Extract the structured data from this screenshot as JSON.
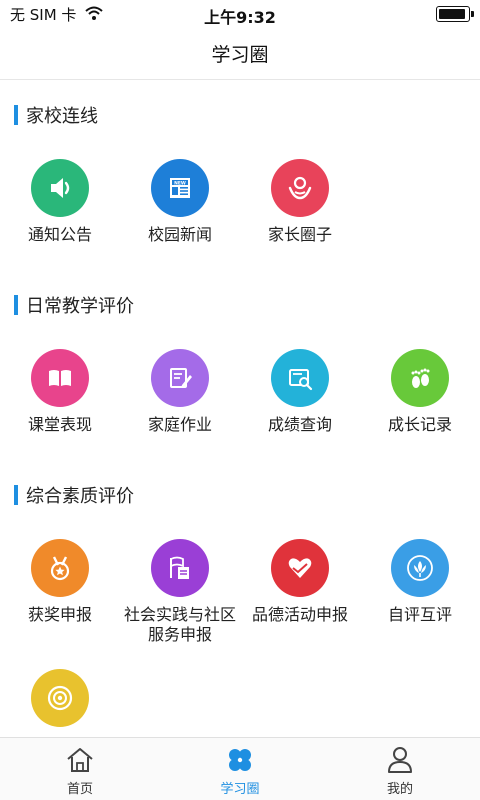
{
  "status_bar": {
    "carrier": "无 SIM 卡",
    "time": "上午9:32"
  },
  "header": {
    "title": "学习圈"
  },
  "sections": [
    {
      "title": "家校连线",
      "items": [
        {
          "label": "通知公告",
          "icon": "speaker-icon",
          "color": "#2ab77a"
        },
        {
          "label": "校园新闻",
          "icon": "newspaper-icon",
          "color": "#1e7fd8"
        },
        {
          "label": "家长圈子",
          "icon": "parent-child-icon",
          "color": "#e8435a"
        }
      ]
    },
    {
      "title": "日常教学评价",
      "items": [
        {
          "label": "课堂表现",
          "icon": "book-icon",
          "color": "#e8448c"
        },
        {
          "label": "家庭作业",
          "icon": "homework-pen-icon",
          "color": "#a46be8"
        },
        {
          "label": "成绩查询",
          "icon": "search-record-icon",
          "color": "#23b2d9"
        },
        {
          "label": "成长记录",
          "icon": "footprint-icon",
          "color": "#68c93a"
        }
      ]
    },
    {
      "title": "综合素质评价",
      "items": [
        {
          "label": "获奖申报",
          "icon": "medal-icon",
          "color": "#f08a2a"
        },
        {
          "label": "社会实践与社区服务申报",
          "label_line1": "社会实践与社区",
          "label_line2": "服务申报",
          "icon": "flag-document-icon",
          "color": "#9a3fd6"
        },
        {
          "label": "品德活动申报",
          "icon": "heart-hand-icon",
          "color": "#e0333b"
        },
        {
          "label": "自评互评",
          "icon": "lotus-icon",
          "color": "#3a9ee6"
        },
        {
          "label": "",
          "icon": "coin-icon",
          "color": "#e8c22e"
        }
      ]
    }
  ],
  "tabs": [
    {
      "label": "首页",
      "icon": "home-icon"
    },
    {
      "label": "学习圈",
      "icon": "clover-icon",
      "active": true
    },
    {
      "label": "我的",
      "icon": "user-icon"
    }
  ],
  "colors": {
    "accent": "#1e8fe1",
    "section_bar": "#1e8fe1"
  }
}
